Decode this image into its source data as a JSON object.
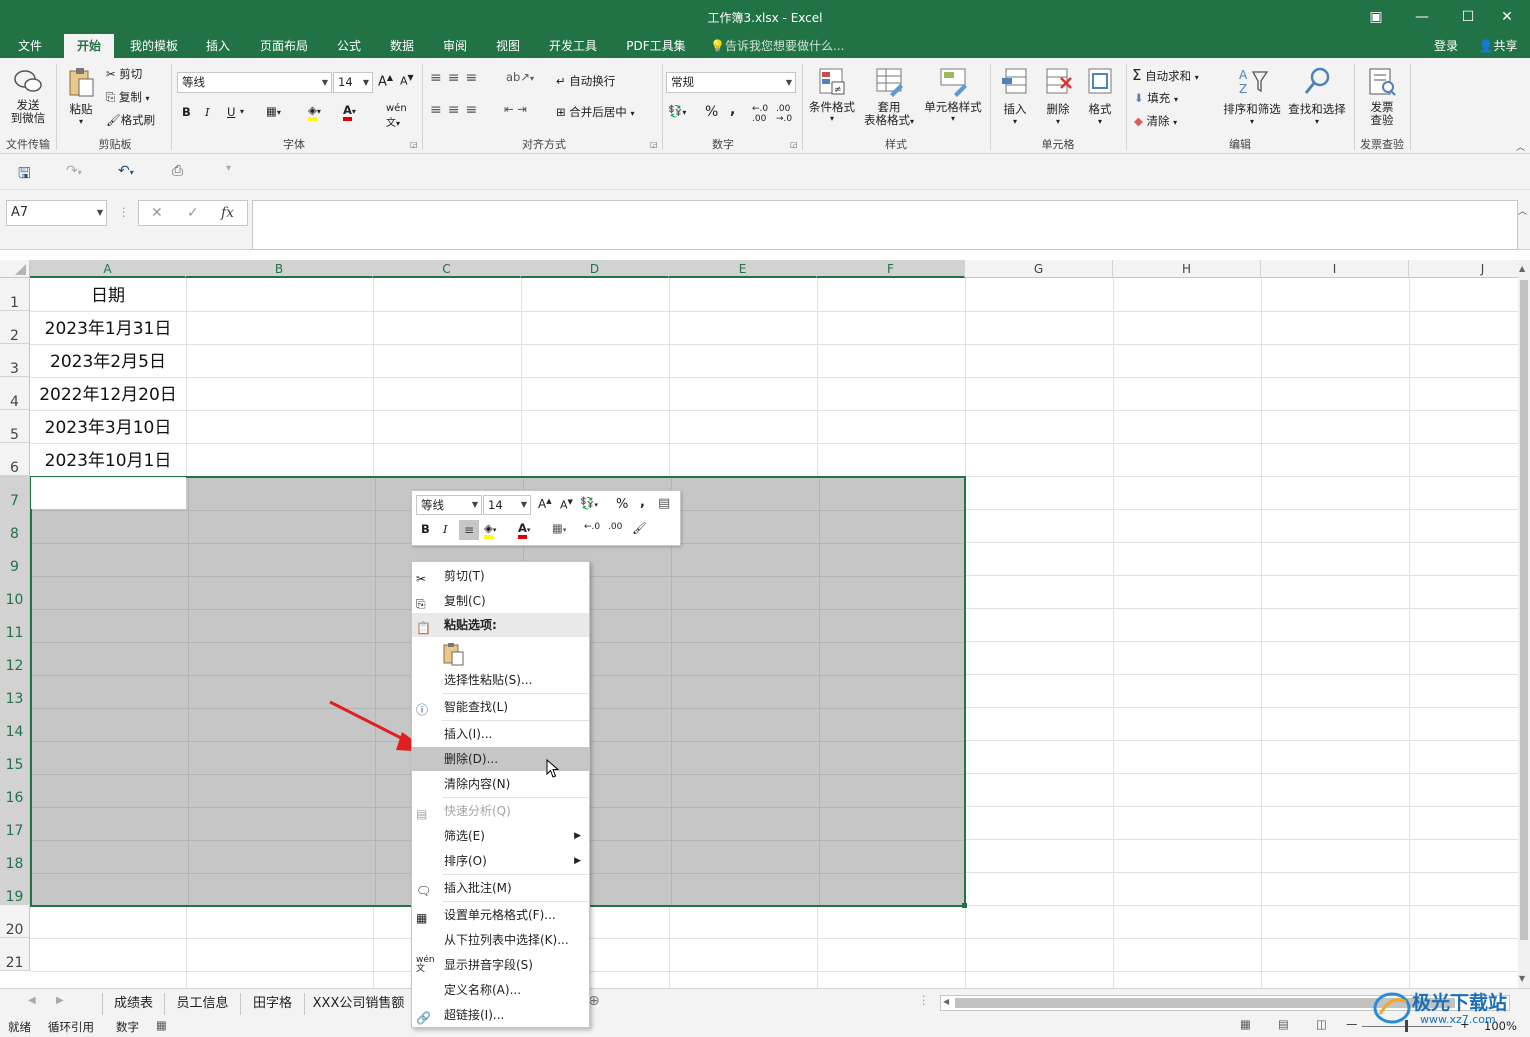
{
  "window": {
    "title": "工作簿3.xlsx - Excel",
    "controls": [
      "▣",
      "—",
      "☐",
      "✕"
    ]
  },
  "tabs": [
    "文件",
    "开始",
    "我的模板",
    "插入",
    "页面布局",
    "公式",
    "数据",
    "审阅",
    "视图",
    "开发工具",
    "PDF工具集"
  ],
  "active_tab": "开始",
  "tell_me": "告诉我您想要做什么...",
  "login": "登录",
  "share": "共享",
  "ribbon": {
    "wechat": {
      "l1": "发送",
      "l2": "到微信",
      "group": "文件传输"
    },
    "clipboard": {
      "paste": "粘贴",
      "cut": "剪切",
      "copy": "复制",
      "format_painter": "格式刷",
      "group": "剪贴板"
    },
    "font": {
      "name": "等线",
      "size": "14",
      "group": "字体",
      "bold": "B",
      "italic": "I",
      "underline": "U"
    },
    "alignment": {
      "wrap": "自动换行",
      "merge": "合并后居中",
      "group": "对齐方式"
    },
    "number": {
      "format": "常规",
      "percent": "%",
      "comma": ",",
      "group": "数字"
    },
    "styles": {
      "cond": "条件格式",
      "table_l1": "套用",
      "table_l2": "表格格式",
      "cell": "单元格样式",
      "group": "样式"
    },
    "cells": {
      "insert": "插入",
      "delete": "删除",
      "format": "格式",
      "group": "单元格"
    },
    "editing": {
      "autosum": "自动求和",
      "fill": "填充",
      "clear": "清除",
      "sort": "排序和筛选",
      "find": "查找和选择",
      "group": "编辑"
    },
    "invoice": {
      "l1": "发票",
      "l2": "查验",
      "group": "发票查验"
    }
  },
  "namebox": "A7",
  "formula_icons": [
    "✕",
    "✓",
    "fx"
  ],
  "columns": [
    "A",
    "B",
    "C",
    "D",
    "E",
    "F",
    "G",
    "H",
    "I",
    "J"
  ],
  "rows": [
    "1",
    "2",
    "3",
    "4",
    "5",
    "6",
    "7",
    "8",
    "9",
    "10",
    "11",
    "12",
    "13",
    "14",
    "15",
    "16",
    "17",
    "18",
    "19",
    "20",
    "21"
  ],
  "cells": {
    "A1": "日期",
    "A2": "2023年1月31日",
    "A3": "2023年2月5日",
    "A4": "2022年12月20日",
    "A5": "2023年3月10日",
    "A6": "2023年10月1日"
  },
  "mini_toolbar": {
    "font": "等线",
    "size": "14"
  },
  "context_menu": [
    {
      "label": "剪切(T)",
      "icon": "scissors-icon"
    },
    {
      "label": "复制(C)",
      "icon": "copy-icon"
    },
    {
      "label": "粘贴选项:",
      "icon": "paste-icon"
    },
    {
      "label": "选择性粘贴(S)...",
      "icon": ""
    },
    {
      "label": "智能查找(L)",
      "icon": "smart-lookup-icon"
    },
    {
      "label": "插入(I)...",
      "icon": ""
    },
    {
      "label": "删除(D)...",
      "icon": ""
    },
    {
      "label": "清除内容(N)",
      "icon": ""
    },
    {
      "label": "快速分析(Q)",
      "icon": "quick-analysis-icon"
    },
    {
      "label": "筛选(E)",
      "icon": ""
    },
    {
      "label": "排序(O)",
      "icon": ""
    },
    {
      "label": "插入批注(M)",
      "icon": "comment-icon"
    },
    {
      "label": "设置单元格格式(F)...",
      "icon": "format-cells-icon"
    },
    {
      "label": "从下拉列表中选择(K)...",
      "icon": ""
    },
    {
      "label": "显示拼音字段(S)",
      "icon": "phonetic-icon"
    },
    {
      "label": "定义名称(A)...",
      "icon": ""
    },
    {
      "label": "超链接(I)...",
      "icon": "hyperlink-icon"
    }
  ],
  "sheets": [
    "成绩表",
    "员工信息",
    "田字格",
    "XXX公司销售额"
  ],
  "status": {
    "ready": "就绪",
    "circular": "循环引用",
    "mode": "数字",
    "zoom": "100%"
  },
  "watermark": "极光下载站",
  "watermark_url": "www.xz7.com",
  "accent": "#217346"
}
